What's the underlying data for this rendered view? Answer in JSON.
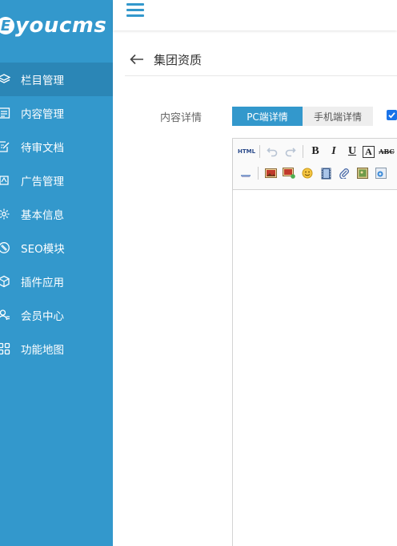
{
  "brand": {
    "mark": "E",
    "text": "youcms"
  },
  "sidebar": {
    "items": [
      {
        "label": "栏目管理",
        "icon": "layers-icon",
        "active": true
      },
      {
        "label": "内容管理",
        "icon": "list-icon"
      },
      {
        "label": "待审文档",
        "icon": "edit-doc-icon"
      },
      {
        "label": "广告管理",
        "icon": "ad-icon"
      },
      {
        "label": "基本信息",
        "icon": "gear-icon"
      },
      {
        "label": "SEO模块",
        "icon": "seo-icon"
      },
      {
        "label": "插件应用",
        "icon": "cube-icon"
      },
      {
        "label": "会员中心",
        "icon": "user-icon"
      },
      {
        "label": "功能地图",
        "icon": "grid-icon"
      }
    ]
  },
  "header": {
    "title": "集团资质"
  },
  "form": {
    "field_label": "内容详情",
    "tabs": [
      {
        "label": "PC端详情",
        "active": true
      },
      {
        "label": "手机端详情",
        "active": false
      }
    ]
  },
  "editor": {
    "toolbar_row1": [
      "html-icon",
      "undo-icon",
      "redo-icon",
      "bold-icon",
      "italic-icon",
      "underline-icon",
      "font-border-icon",
      "strikethrough-icon"
    ],
    "toolbar_row2": [
      "horizontal-rule-icon",
      "image-icon",
      "multi-image-icon",
      "emoticon-icon",
      "video-icon",
      "attachment-icon",
      "picture-frame-icon",
      "link-image-icon"
    ],
    "labels": {
      "html": "HTML",
      "bold": "B",
      "italic": "I",
      "underline": "U",
      "border": "A",
      "strike": "ABC"
    }
  },
  "colors": {
    "primary": "#3398cc",
    "active_item": "#2b86b6",
    "checkbox": "#1a73e8"
  }
}
